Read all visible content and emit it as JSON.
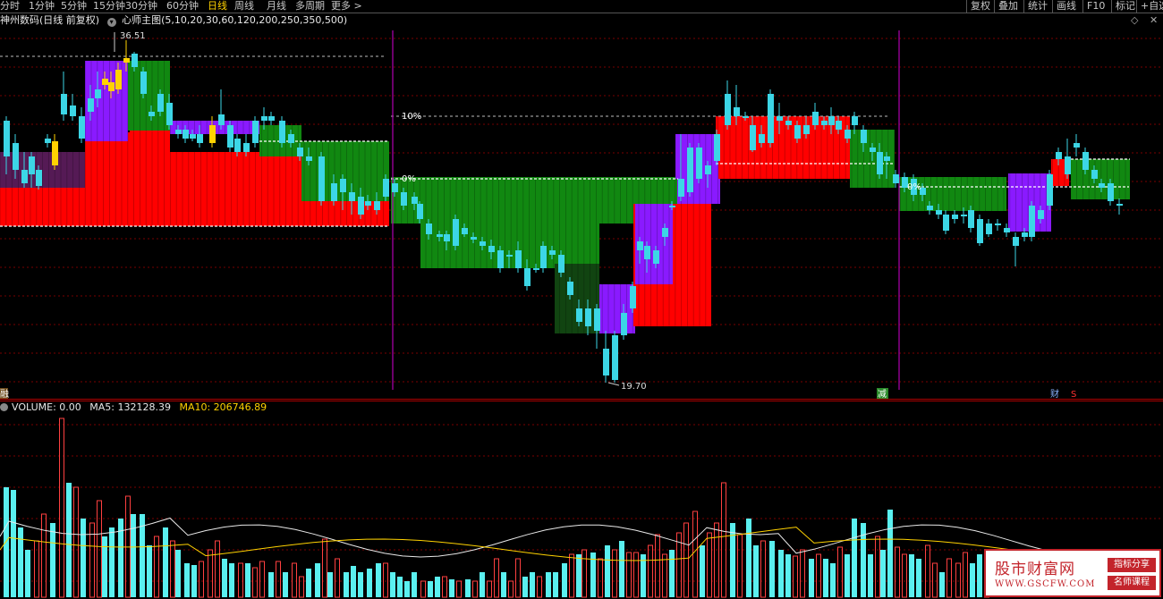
{
  "toolbar": {
    "timeframes": [
      "分时",
      "1分钟",
      "5分钟",
      "15分钟",
      "30分钟",
      "60分钟",
      "日线",
      "周线",
      "月线",
      "多周期",
      "更多 >"
    ],
    "active_timeframe": "日线",
    "right_buttons": [
      "复权",
      "叠加",
      "统计",
      "画线",
      "F10",
      "标记",
      "+自选"
    ]
  },
  "header": {
    "stock": "神州数码(日线 前复权)",
    "indicator": "心师主图",
    "params": "(5,10,20,30,60,120,200,250,350,500)"
  },
  "price_labels": {
    "high": "36.51",
    "low": "19.70"
  },
  "zone_labels": {
    "pct_10": "10%",
    "pct_0": "0%",
    "pct_right": "0%"
  },
  "markers": {
    "left": "融",
    "jian": "减",
    "cai": "财",
    "s": "S"
  },
  "volume": {
    "label": "VOLUME: 0.00",
    "ma5": "MA5: 132128.39",
    "ma10": "MA10: 206746.89"
  },
  "watermark": {
    "title": "股市财富网",
    "url": "WWW.GSCFW.COM",
    "tag1": "指标分享",
    "tag2": "名师课程"
  },
  "colors": {
    "up": "#ffd200",
    "down": "#3cd6e6",
    "zone_red": "#ff0000",
    "zone_green": "#118811",
    "zone_purple": "#8a1aff",
    "divider": "#b000b0",
    "vol_up": "#ff4040",
    "vol_down": "#5af0f0"
  }
}
